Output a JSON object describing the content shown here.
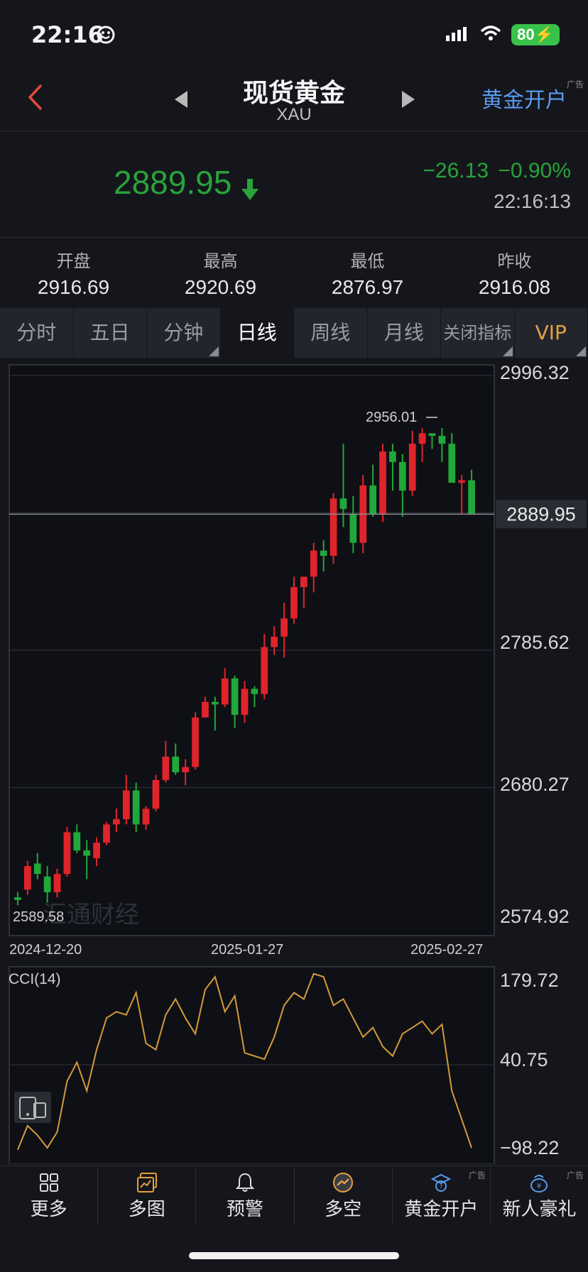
{
  "status": {
    "time": "22:16",
    "battery": "80"
  },
  "nav": {
    "title": "现货黄金",
    "symbol": "XAU",
    "right_link": "黄金开户",
    "ad_tag": "广告"
  },
  "quote": {
    "price": "2889.95",
    "change": "−26.13",
    "percent": "−0.90%",
    "time": "22:16:13"
  },
  "stats": [
    {
      "label": "开盘",
      "value": "2916.69"
    },
    {
      "label": "最高",
      "value": "2920.69"
    },
    {
      "label": "最低",
      "value": "2876.97"
    },
    {
      "label": "昨收",
      "value": "2916.08"
    }
  ],
  "tabs": [
    "分时",
    "五日",
    "分钟",
    "日线",
    "周线",
    "月线",
    "关闭指标",
    "VIP"
  ],
  "active_tab": "日线",
  "chart_data": {
    "type": "candlestick",
    "y_ticks": [
      "2996.32",
      "2785.62",
      "2680.27",
      "2574.92"
    ],
    "current_price_label": "2889.95",
    "high_label": "2956.01",
    "low_label": "2589.58",
    "x_labels": [
      "2024-12-20",
      "2025-01-27",
      "2025-02-27"
    ],
    "ylim": [
      2574.92,
      2996.32
    ],
    "up_color": "#e0242b",
    "down_color": "#21a83a",
    "watermark": "汇通财经",
    "candles": [
      [
        2596,
        2600,
        2590,
        2594
      ],
      [
        2602,
        2624,
        2598,
        2620
      ],
      [
        2622,
        2630,
        2610,
        2614
      ],
      [
        2612,
        2620,
        2592,
        2600
      ],
      [
        2600,
        2618,
        2596,
        2614
      ],
      [
        2614,
        2650,
        2612,
        2646
      ],
      [
        2646,
        2652,
        2630,
        2632
      ],
      [
        2632,
        2640,
        2610,
        2628
      ],
      [
        2626,
        2642,
        2620,
        2638
      ],
      [
        2638,
        2654,
        2636,
        2652
      ],
      [
        2652,
        2664,
        2646,
        2656
      ],
      [
        2656,
        2690,
        2652,
        2678
      ],
      [
        2678,
        2684,
        2646,
        2652
      ],
      [
        2652,
        2666,
        2648,
        2664
      ],
      [
        2664,
        2690,
        2662,
        2686
      ],
      [
        2686,
        2716,
        2684,
        2704
      ],
      [
        2704,
        2714,
        2690,
        2692
      ],
      [
        2692,
        2702,
        2682,
        2696
      ],
      [
        2696,
        2738,
        2694,
        2734
      ],
      [
        2734,
        2750,
        2734,
        2746
      ],
      [
        2746,
        2750,
        2724,
        2744
      ],
      [
        2744,
        2772,
        2742,
        2764
      ],
      [
        2764,
        2766,
        2726,
        2736
      ],
      [
        2736,
        2762,
        2730,
        2756
      ],
      [
        2756,
        2758,
        2742,
        2752
      ],
      [
        2752,
        2798,
        2748,
        2788
      ],
      [
        2788,
        2804,
        2782,
        2796
      ],
      [
        2796,
        2822,
        2780,
        2810
      ],
      [
        2810,
        2842,
        2806,
        2834
      ],
      [
        2834,
        2842,
        2818,
        2842
      ],
      [
        2842,
        2868,
        2830,
        2862
      ],
      [
        2862,
        2870,
        2846,
        2858
      ],
      [
        2858,
        2906,
        2852,
        2902
      ],
      [
        2902,
        2944,
        2880,
        2894
      ],
      [
        2890,
        2904,
        2860,
        2868
      ],
      [
        2868,
        2920,
        2860,
        2912
      ],
      [
        2912,
        2928,
        2888,
        2890
      ],
      [
        2890,
        2944,
        2884,
        2938
      ],
      [
        2938,
        2944,
        2908,
        2930
      ],
      [
        2930,
        2936,
        2888,
        2908
      ],
      [
        2908,
        2954,
        2904,
        2944
      ],
      [
        2944,
        2956,
        2930,
        2952
      ],
      [
        2952,
        2950,
        2940,
        2950
      ],
      [
        2950,
        2956,
        2930,
        2944
      ],
      [
        2944,
        2952,
        2916,
        2914
      ],
      [
        2914,
        2920,
        2890,
        2916
      ],
      [
        2916,
        2924,
        2890,
        2890
      ]
    ],
    "indicator": {
      "name": "CCI(14)",
      "y_ticks": [
        "179.72",
        "40.75",
        "−98.22"
      ],
      "ylim": [
        -98.22,
        179.72
      ],
      "color": "#d49a3a",
      "values": [
        -98,
        -60,
        -75,
        -95,
        -70,
        10,
        40,
        -5,
        60,
        110,
        120,
        115,
        150,
        70,
        60,
        115,
        140,
        110,
        85,
        155,
        175,
        120,
        145,
        55,
        50,
        45,
        80,
        130,
        150,
        140,
        180,
        175,
        130,
        140,
        110,
        80,
        95,
        65,
        50,
        85,
        95,
        105,
        85,
        100,
        -5,
        -50,
        -95
      ]
    }
  },
  "bottom_nav": [
    {
      "label": "更多",
      "icon": "grid-icon"
    },
    {
      "label": "多图",
      "icon": "multi-chart-icon"
    },
    {
      "label": "预警",
      "icon": "bell-icon"
    },
    {
      "label": "多空",
      "icon": "trend-icon"
    },
    {
      "label": "黄金开户",
      "icon": "gold-account-icon",
      "ad": "广告"
    },
    {
      "label": "新人豪礼",
      "icon": "gift-bag-icon",
      "ad": "广告"
    }
  ]
}
